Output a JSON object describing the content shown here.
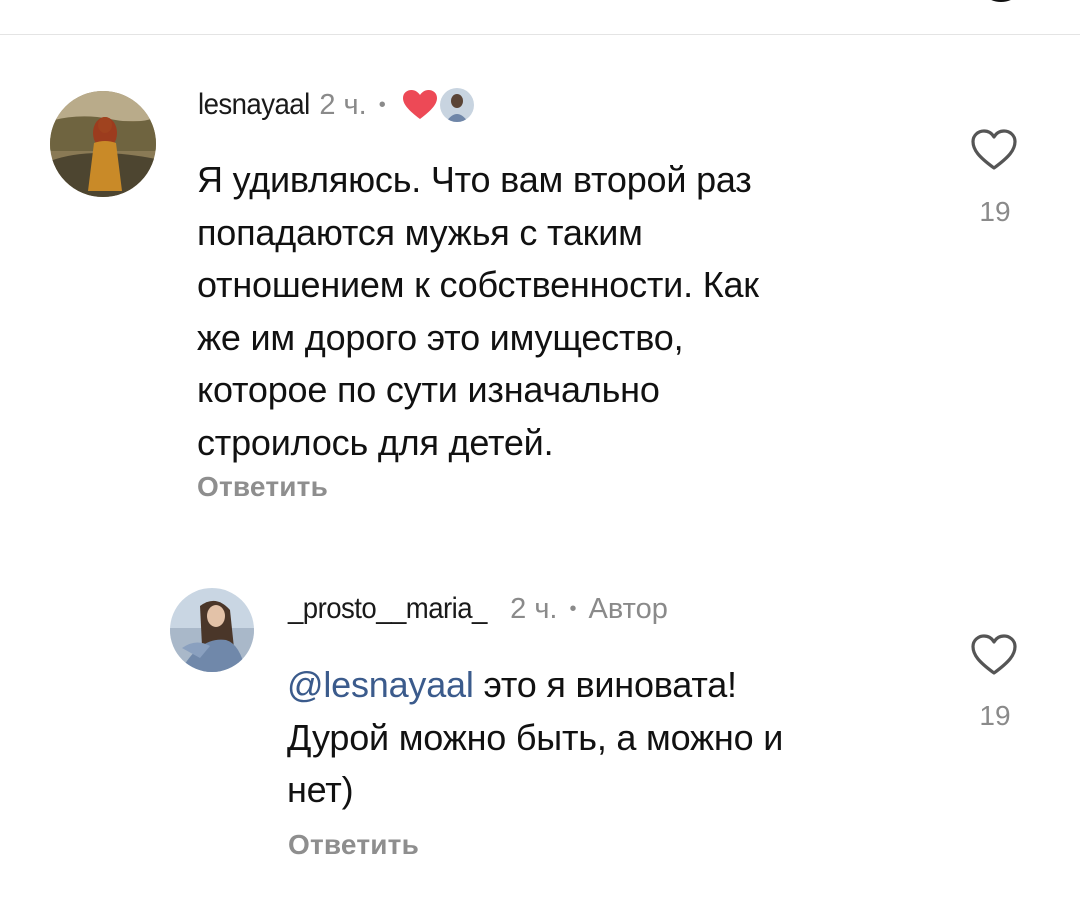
{
  "comments": [
    {
      "username": "lesnayaal",
      "time": "2 ч.",
      "separator": "•",
      "text_lines": [
        "Я удивляюсь. Что вам второй раз",
        "попадаются мужья с таким",
        "отношением к собственности. Как",
        "же им дорого это имущество,",
        "которое по сути изначально",
        "строилось для детей."
      ],
      "reply_label": "Ответить",
      "like_count": "19",
      "liked_by_author": true,
      "heart_color": "#ed4956"
    },
    {
      "username": "_prosto__maria_",
      "time": "2 ч.",
      "separator": "•",
      "author_label": "Автор",
      "mention": "@lesnayaal",
      "text_first_line_rest": " это я виновата!",
      "text_lines": [
        "Дурой можно быть, а можно и",
        "нет)"
      ],
      "reply_label": "Ответить",
      "like_count": "19"
    }
  ],
  "colors": {
    "mention": "#3b5b8c",
    "secondary_text": "#8a8a8a",
    "heart": "#ed4956"
  }
}
